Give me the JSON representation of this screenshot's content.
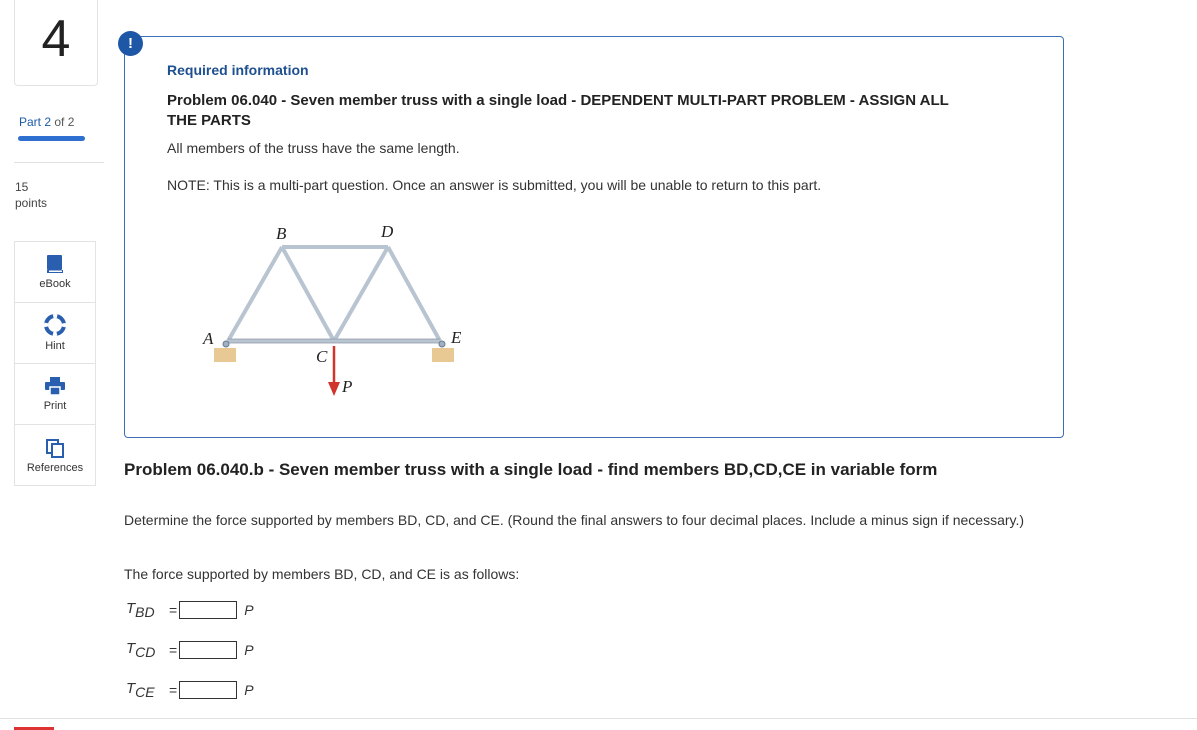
{
  "question": {
    "number": "4",
    "part_current": "Part 2",
    "part_of": "of 2",
    "progress": 1.0,
    "points_value": "15",
    "points_label": "points"
  },
  "tools": [
    {
      "label": "eBook",
      "icon": "book-icon"
    },
    {
      "label": "Hint",
      "icon": "lifebuoy-icon"
    },
    {
      "label": "Print",
      "icon": "printer-icon"
    },
    {
      "label": "References",
      "icon": "copy-icon"
    }
  ],
  "required": {
    "badge": "!",
    "heading": "Required information",
    "problem_title": "Problem 06.040 - Seven member truss with a single load - DEPENDENT MULTI-PART PROBLEM - ASSIGN ALL THE PARTS",
    "line1": "All members of the truss have the same length.",
    "line2": "NOTE: This is a multi-part question. Once an answer is submitted, you will be unable to return to this part."
  },
  "figure": {
    "labels": {
      "A": "A",
      "B": "B",
      "C": "C",
      "D": "D",
      "E": "E",
      "P": "P"
    },
    "colors": {
      "member": "#b8c4d0",
      "load": "#d0342c",
      "support": "#e8c893"
    }
  },
  "part": {
    "title": "Problem 06.040.b - Seven member truss with a single load - find members BD,CD,CE in variable form",
    "instruction": "Determine the force supported by members BD, CD, and CE. (Round the final answers to four decimal places. Include a minus sign if necessary.)",
    "follows": "The force supported by members BD, CD, and CE is as follows:",
    "answers": [
      {
        "symbol": "T",
        "sub": "BD",
        "eq": "=",
        "value": "",
        "unit": "P"
      },
      {
        "symbol": "T",
        "sub": "CD",
        "eq": "=",
        "value": "",
        "unit": "P"
      },
      {
        "symbol": "T",
        "sub": "CE",
        "eq": "=",
        "value": "",
        "unit": "P"
      }
    ]
  }
}
